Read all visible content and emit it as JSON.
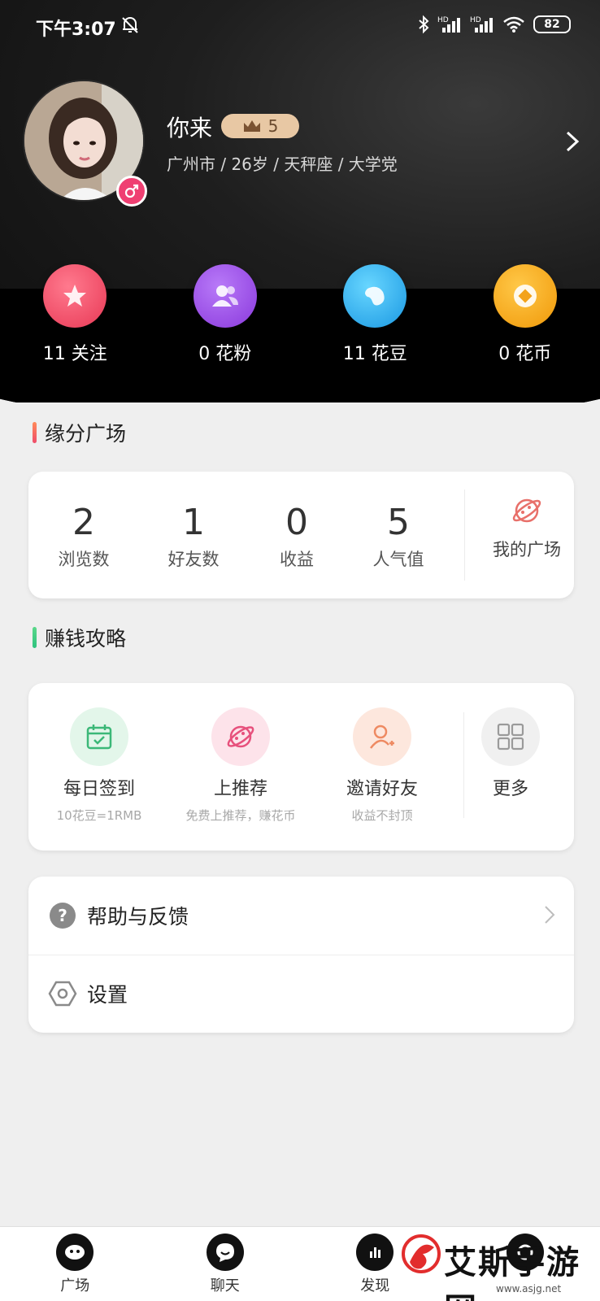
{
  "status_bar": {
    "time": "下午3:07",
    "battery": "82"
  },
  "profile": {
    "name": "你来",
    "level": "5",
    "info": "广州市 / 26岁 / 天秤座 / 大学党"
  },
  "stats": [
    {
      "label": "11 关注",
      "icon": "star-icon",
      "color": "#ef4d6a"
    },
    {
      "label": "0 花粉",
      "icon": "users-icon",
      "color": "#9a4ce6"
    },
    {
      "label": "11 花豆",
      "icon": "bean-icon",
      "color": "#22a8e8"
    },
    {
      "label": "0 花币",
      "icon": "coin-icon",
      "color": "#f5a012"
    }
  ],
  "yuanfen": {
    "title": "缘分广场",
    "accent": "#ef5a5a",
    "items": [
      {
        "value": "2",
        "label": "浏览数"
      },
      {
        "value": "1",
        "label": "好友数"
      },
      {
        "value": "0",
        "label": "收益"
      },
      {
        "value": "5",
        "label": "人气值"
      }
    ],
    "plaza_label": "我的广场"
  },
  "earn": {
    "title": "赚钱攻略",
    "accent": "#2ec27e",
    "items": [
      {
        "label": "每日签到",
        "sub": "10花豆=1RMB",
        "icon": "calendar-check-icon"
      },
      {
        "label": "上推荐",
        "sub": "免费上推荐，赚花币",
        "icon": "planet-icon"
      },
      {
        "label": "邀请好友",
        "sub": "收益不封顶",
        "icon": "add-user-icon"
      },
      {
        "label": "更多",
        "sub": "",
        "icon": "grid-icon"
      }
    ]
  },
  "menu": [
    {
      "label": "帮助与反馈",
      "icon": "help-icon"
    },
    {
      "label": "设置",
      "icon": "settings-hexagon-icon"
    }
  ],
  "nav": [
    {
      "label": "广场",
      "icon": "planet-face-icon"
    },
    {
      "label": "聊天",
      "icon": "chat-face-icon"
    },
    {
      "label": "发现",
      "icon": "discover-icon"
    },
    {
      "label": "",
      "icon": "profile-icon"
    }
  ],
  "watermark": {
    "text": "艾斯手游网",
    "url": "www.asjg.net"
  }
}
